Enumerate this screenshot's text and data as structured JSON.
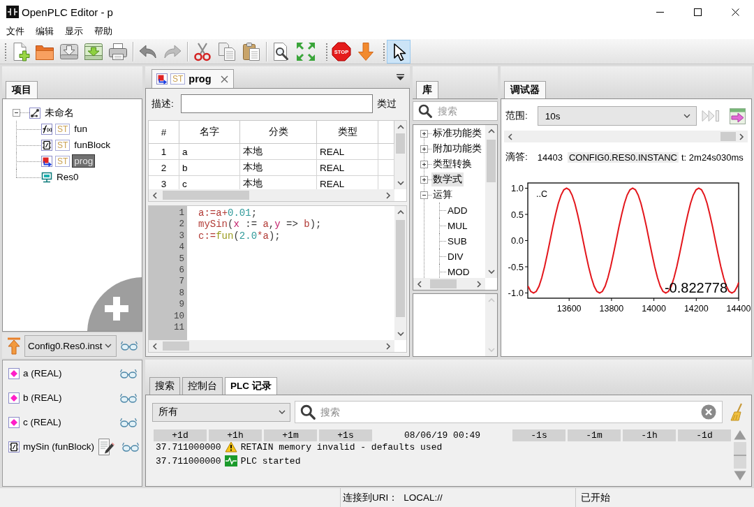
{
  "window": {
    "title": "OpenPLC Editor - p"
  },
  "menu": [
    "文件",
    "编辑",
    "显示",
    "帮助"
  ],
  "toolbars": [
    {
      "groups": [
        {
          "items": [
            {
              "kind": "new",
              "selected": false
            },
            {
              "kind": "open",
              "selected": false
            },
            {
              "kind": "save",
              "selected": false
            },
            {
              "kind": "generate",
              "selected": false
            },
            {
              "kind": "print",
              "selected": false
            }
          ]
        },
        {
          "items": [
            {
              "kind": "undo",
              "selected": false
            },
            {
              "kind": "redo",
              "selected": false
            }
          ]
        },
        {
          "items": [
            {
              "kind": "cut",
              "selected": false
            },
            {
              "kind": "copy",
              "selected": false
            },
            {
              "kind": "paste",
              "selected": false
            }
          ]
        },
        {
          "items": [
            {
              "kind": "find",
              "selected": false
            },
            {
              "kind": "fullscreen",
              "selected": false
            }
          ]
        }
      ]
    },
    {
      "groups": [
        {
          "items": [
            {
              "kind": "stop",
              "text": "STOP",
              "selected": false
            },
            {
              "kind": "transfer",
              "selected": false
            }
          ]
        }
      ]
    },
    {
      "groups": [
        {
          "items": [
            {
              "kind": "pointer",
              "selected": true
            }
          ]
        }
      ]
    }
  ],
  "project": {
    "tab": {
      "label": "项目",
      "selected": true
    },
    "tree": [
      {
        "label": "未命名",
        "kind": "project",
        "expanded": true,
        "selected": false,
        "children": [
          {
            "label": "fun",
            "kind": "function",
            "language": "ST",
            "selected": false
          },
          {
            "label": "funBlock",
            "kind": "function_block",
            "language": "ST",
            "selected": false
          },
          {
            "label": "prog",
            "kind": "program",
            "language": "ST",
            "selected": true
          },
          {
            "label": "Res0",
            "kind": "resource",
            "selected": false
          }
        ]
      }
    ]
  },
  "instance": {
    "value": "Config0.Res0.inst"
  },
  "variables": [
    {
      "label": "a (REAL)",
      "kind": "variable"
    },
    {
      "label": "b (REAL)",
      "kind": "variable"
    },
    {
      "label": "c (REAL)",
      "kind": "variable"
    },
    {
      "label": "mySin (funBlock)",
      "kind": "function_block"
    }
  ],
  "editor": {
    "tabs": [
      {
        "label": "prog",
        "kind": "program",
        "language": "ST",
        "selected": true
      }
    ],
    "description": {
      "label": "描述:"
    },
    "class_filter_label": "类过",
    "table": {
      "columns": [
        "#",
        "名字",
        "分类",
        "类型"
      ],
      "rows": [
        {
          "cells": [
            "1",
            "a",
            "本地",
            "REAL"
          ]
        },
        {
          "cells": [
            "2",
            "b",
            "本地",
            "REAL"
          ]
        },
        {
          "cells": [
            "3",
            "c",
            "本地",
            "REAL"
          ]
        }
      ]
    },
    "code": {
      "lines": [
        {
          "number": "1",
          "tokens": [
            {
              "text": "a",
              "kind": "variable"
            },
            {
              "text": ":=",
              "kind": "operator"
            },
            {
              "text": "a",
              "kind": "variable"
            },
            {
              "text": "+",
              "kind": "operator"
            },
            {
              "text": "0.01",
              "kind": "number"
            },
            {
              "text": ";",
              "kind": "punctuation"
            }
          ]
        },
        {
          "number": "2",
          "tokens": [
            {
              "text": "mySin",
              "kind": "variable"
            },
            {
              "text": "(",
              "kind": "punctuation"
            },
            {
              "text": "x",
              "kind": "parameter"
            },
            {
              "text": " := ",
              "kind": "punctuation"
            },
            {
              "text": "a",
              "kind": "variable"
            },
            {
              "text": ",",
              "kind": "punctuation"
            },
            {
              "text": "y",
              "kind": "parameter"
            },
            {
              "text": " => ",
              "kind": "punctuation"
            },
            {
              "text": "b",
              "kind": "variable"
            },
            {
              "text": ");",
              "kind": "punctuation"
            }
          ]
        },
        {
          "number": "3",
          "tokens": [
            {
              "text": "c",
              "kind": "variable"
            },
            {
              "text": ":=",
              "kind": "operator"
            },
            {
              "text": "fun",
              "kind": "function"
            },
            {
              "text": "(",
              "kind": "punctuation"
            },
            {
              "text": "2.0",
              "kind": "number"
            },
            {
              "text": "*",
              "kind": "operator"
            },
            {
              "text": "a",
              "kind": "variable"
            },
            {
              "text": ");",
              "kind": "punctuation"
            }
          ]
        },
        {
          "number": "4"
        },
        {
          "number": "5"
        },
        {
          "number": "6"
        },
        {
          "number": "7"
        },
        {
          "number": "8"
        },
        {
          "number": "9"
        },
        {
          "number": "10"
        },
        {
          "number": "11"
        }
      ]
    }
  },
  "library": {
    "tab": {
      "label": "库",
      "selected": true
    },
    "search": {
      "placeholder": "搜索"
    },
    "tree": [
      {
        "label": "标准功能类",
        "expanded": false,
        "selected": false
      },
      {
        "label": "附加功能类",
        "expanded": false,
        "selected": false
      },
      {
        "label": "类型转换",
        "expanded": false,
        "selected": false
      },
      {
        "label": "数学式",
        "expanded": false,
        "selected": true
      },
      {
        "label": "运算",
        "expanded": true,
        "selected": false,
        "children": [
          {
            "label": "ADD",
            "selected": false
          },
          {
            "label": "MUL",
            "selected": false
          },
          {
            "label": "SUB",
            "selected": false
          },
          {
            "label": "DIV",
            "selected": false
          },
          {
            "label": "MOD",
            "selected": false
          }
        ]
      }
    ]
  },
  "debugger": {
    "tab": {
      "label": "调试器",
      "selected": true
    },
    "range": {
      "label": "范围:",
      "value": "10s"
    },
    "buttons": [
      {
        "kind": "skip_forward",
        "disabled": true
      },
      {
        "kind": "export",
        "disabled": false
      }
    ],
    "tick": {
      "label": "滴答:",
      "value": "14403"
    },
    "variable": "CONFIG0.RES0.INSTANC",
    "time": "t: 2m24s030ms",
    "chart_data": {
      "type": "line",
      "x": [
        13406,
        13419,
        13432,
        13445,
        13458,
        13471,
        13484,
        13497,
        13510,
        13523,
        13536,
        13549,
        13562,
        13575,
        13588,
        13601,
        13614,
        13627,
        13640,
        13653,
        13666,
        13679,
        13692,
        13705,
        13718,
        13731,
        13744,
        13757,
        13770,
        13783,
        13796,
        13809,
        13822,
        13835,
        13848,
        13861,
        13874,
        13887,
        13900,
        13913,
        13926,
        13939,
        13952,
        13965,
        13978,
        13991,
        14004,
        14017,
        14030,
        14043,
        14056,
        14069,
        14082,
        14095,
        14108,
        14121,
        14134,
        14147,
        14160,
        14173,
        14186,
        14199,
        14212,
        14225,
        14238,
        14251,
        14264,
        14277,
        14290,
        14303,
        14316,
        14329,
        14342,
        14355,
        14368,
        14381,
        14394,
        14400
      ],
      "series": [
        {
          "name": "..C",
          "color": "#e3161c",
          "values": [
            -0.87,
            -0.97,
            -1,
            -0.97,
            -0.87,
            -0.71,
            -0.5,
            -0.26,
            0,
            0.26,
            0.5,
            0.71,
            0.87,
            0.97,
            1,
            0.97,
            0.87,
            0.71,
            0.5,
            0.26,
            0,
            -0.26,
            -0.5,
            -0.71,
            -0.87,
            -0.97,
            -1,
            -0.97,
            -0.87,
            -0.71,
            -0.5,
            -0.26,
            0,
            0.26,
            0.5,
            0.71,
            0.87,
            0.97,
            1,
            0.97,
            0.87,
            0.71,
            0.5,
            0.26,
            0,
            -0.26,
            -0.5,
            -0.71,
            -0.87,
            -0.97,
            -1,
            -0.97,
            -0.87,
            -0.71,
            -0.5,
            -0.26,
            0,
            0.26,
            0.5,
            0.71,
            0.87,
            0.97,
            1,
            0.97,
            0.87,
            0.71,
            0.5,
            0.26,
            0,
            -0.26,
            -0.5,
            -0.71,
            -0.87,
            -0.97,
            -1,
            -0.97,
            -0.87,
            -0.8
          ]
        }
      ],
      "xlim": [
        13405,
        14400
      ],
      "ylim": [
        -1.1,
        1.1
      ],
      "xticks": [
        13600,
        13800,
        14000,
        14200,
        14400
      ],
      "yticks": [
        {
          "value": 1,
          "label": "1.0"
        },
        {
          "value": 0.5,
          "label": "0.5"
        },
        {
          "value": 0,
          "label": "0.0"
        },
        {
          "value": -0.5,
          "label": "-0.5"
        },
        {
          "value": -1,
          "label": "-1.0"
        }
      ],
      "annotations": [
        {
          "text": "-0.822778"
        }
      ]
    }
  },
  "log": {
    "tabs": [
      {
        "label": "搜索",
        "selected": false
      },
      {
        "label": "控制台",
        "selected": false
      },
      {
        "label": "PLC 记录",
        "selected": true
      }
    ],
    "filter": {
      "value": "所有"
    },
    "search": {
      "placeholder": "搜索"
    },
    "steps_forward": [
      "+1d",
      "+1h",
      "+1m",
      "+1s"
    ],
    "timestamp": "08/06/19 00:49",
    "steps_back": [
      "-1s",
      "-1m",
      "-1h",
      "-1d"
    ],
    "entries": [
      {
        "time": "37.711000000",
        "kind": "warning",
        "message": "RETAIN memory invalid - defaults used"
      },
      {
        "time": "37.711000000",
        "kind": "info",
        "message": "PLC started"
      }
    ]
  },
  "status_bar": {
    "connection_label": "连接到URI：",
    "connection_uri": "LOCAL://",
    "state": "已开始"
  }
}
